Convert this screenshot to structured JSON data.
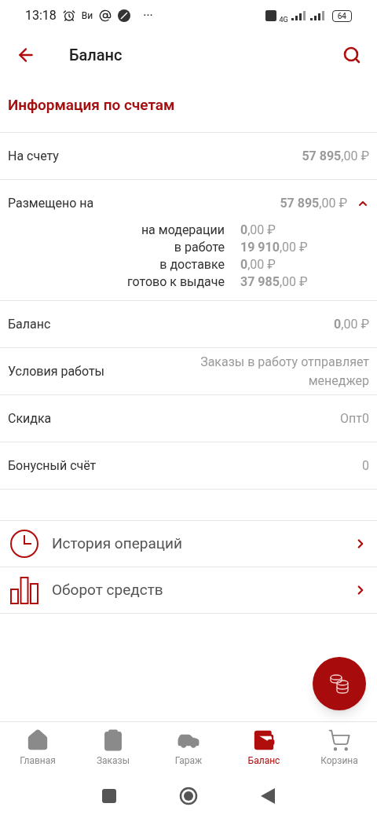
{
  "status_bar": {
    "time": "13:18",
    "carrier": "Ви",
    "more": "···",
    "network": "4G",
    "battery": "64"
  },
  "header": {
    "title": "Баланс"
  },
  "section_title": "Информация по счетам",
  "rows": [
    {
      "label": "На счету",
      "value": "**57 895**,00 ₽"
    },
    {
      "label": "Размещено на",
      "value": "**57 895**,00 ₽",
      "expanded": true,
      "details": [
        {
          "label": "на модерации",
          "value": "**0**,00 ₽"
        },
        {
          "label": "в работе",
          "value": "**19 910**,00 ₽"
        },
        {
          "label": "в доставке",
          "value": "**0**,00 ₽"
        },
        {
          "label": "готово к выдаче",
          "value": "**37 985**,00 ₽"
        }
      ]
    },
    {
      "label": "Баланс",
      "value": "**0**,00 ₽"
    },
    {
      "label": "Условия работы",
      "value": "Заказы в работу отправляет менеджер"
    },
    {
      "label": "Скидка",
      "value": "Опт0"
    },
    {
      "label": "Бонусный счёт",
      "value": "0"
    }
  ],
  "links": [
    {
      "kind": "history",
      "label": "История операций"
    },
    {
      "kind": "turnover",
      "label": "Оборот средств"
    }
  ],
  "bottom_nav": [
    {
      "kind": "home",
      "label": "Главная",
      "selected": false
    },
    {
      "kind": "orders",
      "label": "Заказы",
      "selected": false
    },
    {
      "kind": "garage",
      "label": "Гараж",
      "selected": false
    },
    {
      "kind": "balance",
      "label": "Баланс",
      "selected": true
    },
    {
      "kind": "cart",
      "label": "Корзина",
      "selected": false
    }
  ]
}
